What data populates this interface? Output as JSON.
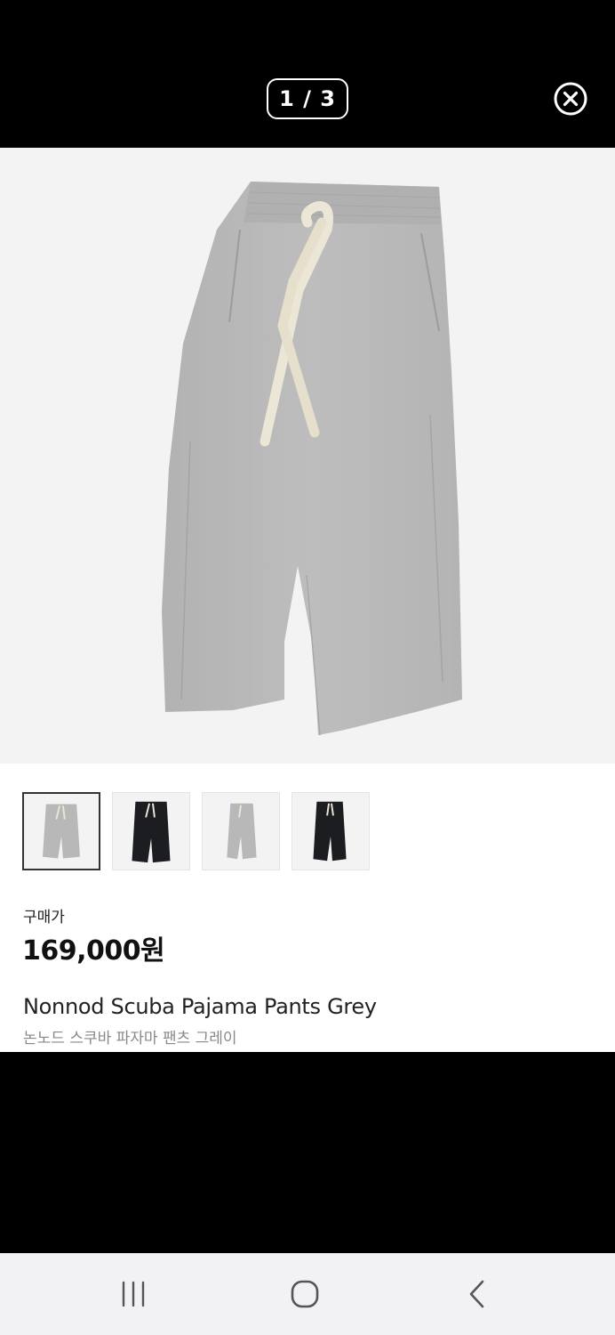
{
  "viewer": {
    "counter": "1 / 3",
    "close_icon": "close-circle-icon"
  },
  "gallery": {
    "thumbnails": [
      {
        "color": "grey",
        "selected": true
      },
      {
        "color": "black",
        "selected": false
      },
      {
        "color": "grey",
        "selected": false
      },
      {
        "color": "black",
        "selected": false
      }
    ]
  },
  "product": {
    "price_label": "구매가",
    "price": "169,000원",
    "name_en": "Nonnod Scuba Pajama Pants Grey",
    "name_ko": "논노드 스쿠바 파자마 팬츠 그레이"
  },
  "system_nav": {
    "recents_icon": "recents-icon",
    "home_icon": "home-icon",
    "back_icon": "back-icon"
  },
  "colors": {
    "background": "#000000",
    "hero_bg": "#f3f3f4",
    "pants_grey": "#b9b9b9",
    "drawstring": "#ece6d6",
    "pants_black": "#1c1d21"
  }
}
